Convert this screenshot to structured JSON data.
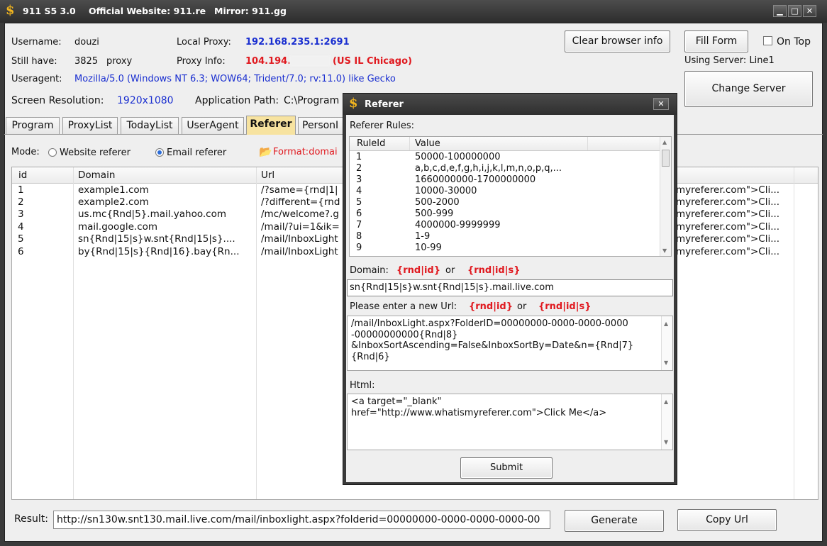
{
  "titlebar": {
    "app": "911 S5 3.0",
    "website": "Official Website: 911.re",
    "mirror": "Mirror: 911.gg",
    "minimize": "▁",
    "maximize": "□",
    "close": "✕"
  },
  "info": {
    "username_label": "Username:",
    "username_value": "douzi",
    "stillhave_label": "Still have:",
    "stillhave_value": "3825",
    "stillhave_unit": "proxy",
    "useragent_label": "Useragent:",
    "useragent_value": "Mozilla/5.0 (Windows NT 6.3; WOW64; Trident/7.0; rv:11.0) like Gecko",
    "resolution_label": "Screen Resolution:",
    "resolution_value": "1920x1080",
    "localproxy_label": "Local Proxy:",
    "localproxy_value": "192.168.235.1:2691",
    "proxyinfo_label": "Proxy Info:",
    "proxyinfo_ip": "104.194.",
    "proxyinfo_loc": "(US IL Chicago)",
    "apppath_label": "Application Path:",
    "apppath_value": "C:\\Program"
  },
  "buttons": {
    "clear_browser": "Clear browser info",
    "fill_form": "Fill Form",
    "on_top": "On Top",
    "using_server": "Using Server: Line1",
    "change_server": "Change Server",
    "generate": "Generate",
    "copy_url": "Copy Url"
  },
  "tabs": [
    "Program",
    "ProxyList",
    "TodayList",
    "UserAgent",
    "Referer",
    "PersonI"
  ],
  "mode": {
    "label": "Mode:",
    "website": "Website referer",
    "email": "Email referer",
    "format": "Format:domai"
  },
  "grid": {
    "headers": [
      "id",
      "Domain",
      "Url"
    ],
    "rows": [
      {
        "id": "1",
        "domain": "example1.com",
        "url": "/?same={rnd|1|",
        "html": "myreferer.com\">Cli..."
      },
      {
        "id": "2",
        "domain": "example2.com",
        "url": "/?different={rnd",
        "html": "myreferer.com\">Cli..."
      },
      {
        "id": "3",
        "domain": "us.mc{Rnd|5}.mail.yahoo.com",
        "url": "/mc/welcome?.g",
        "html": "myreferer.com\">Cli..."
      },
      {
        "id": "4",
        "domain": "mail.google.com",
        "url": "/mail/?ui=1&ik=",
        "html": "myreferer.com\">Cli..."
      },
      {
        "id": "5",
        "domain": "sn{Rnd|15|s}w.snt{Rnd|15|s}....",
        "url": "/mail/InboxLight",
        "html": "myreferer.com\">Cli..."
      },
      {
        "id": "6",
        "domain": "by{Rnd|15|s}{Rnd|16}.bay{Rn...",
        "url": "/mail/InboxLight",
        "html": "myreferer.com\">Cli..."
      }
    ]
  },
  "result": {
    "label": "Result:",
    "value": "http://sn130w.snt130.mail.live.com/mail/inboxlight.aspx?folderid=00000000-0000-0000-0000-00"
  },
  "dialog": {
    "title": "Referer",
    "rules_label": "Referer Rules:",
    "rules_headers": [
      "RuleId",
      "Value"
    ],
    "rules": [
      {
        "id": "1",
        "value": "50000-100000000"
      },
      {
        "id": "2",
        "value": "a,b,c,d,e,f,g,h,i,j,k,l,m,n,o,p,q,..."
      },
      {
        "id": "3",
        "value": "1660000000-1700000000"
      },
      {
        "id": "4",
        "value": "10000-30000"
      },
      {
        "id": "5",
        "value": "500-2000"
      },
      {
        "id": "6",
        "value": "500-999"
      },
      {
        "id": "7",
        "value": "4000000-9999999"
      },
      {
        "id": "8",
        "value": "1-9"
      },
      {
        "id": "9",
        "value": "10-99"
      }
    ],
    "domain_label": "Domain:",
    "token_id": "{rnd|id}",
    "or": "or",
    "token_ids": "{rnd|id|s}",
    "domain_value": "sn{Rnd|15|s}w.snt{Rnd|15|s}.mail.live.com",
    "url_label": "Please enter a new Url:",
    "url_value": "/mail/InboxLight.aspx?FolderID=00000000-0000-0000-0000-00000000000{Rnd|8}&InboxSortAscending=False&InboxSortBy=Date&n={Rnd|7}{Rnd|6}",
    "url_lines": [
      "/mail/InboxLight.aspx?FolderID=00000000-0000-0000-0000",
      "-00000000000{Rnd|8}",
      "&InboxSortAscending=False&InboxSortBy=Date&n={Rnd|7}",
      "{Rnd|6}"
    ],
    "html_label": "Html:",
    "html_lines": [
      "<a target=\"_blank\"",
      "href=\"http://www.whatismyreferer.com\">Click Me</a>"
    ],
    "submit": "Submit",
    "close": "✕"
  },
  "colors": {
    "accent_blue": "#1a2fd0",
    "accent_red": "#e0191f",
    "tab_active": "#f7e3a0",
    "logo": "#f2b51e"
  }
}
